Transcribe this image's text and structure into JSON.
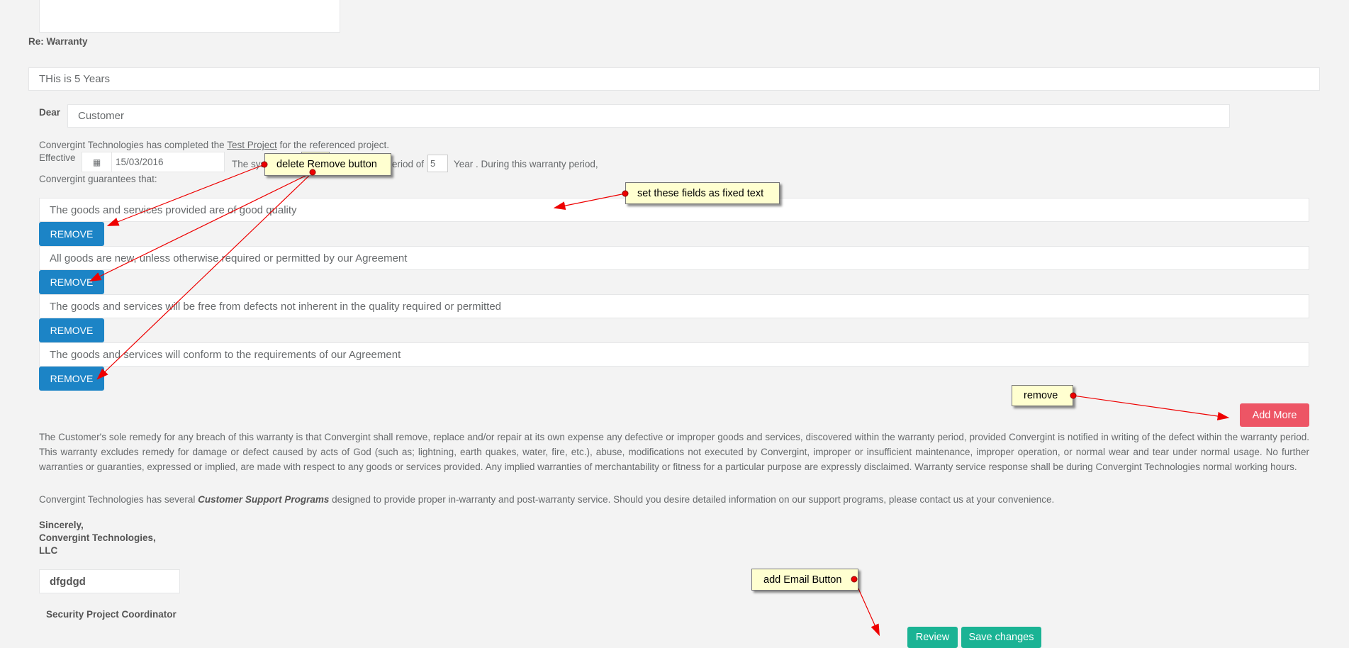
{
  "re_label": "Re: Warranty",
  "subject_value": "THis is 5 Years",
  "dear_label": "Dear",
  "dear_value": "Customer",
  "intro": {
    "before": "Convergint Technologies has completed the ",
    "project_link": "Test Project",
    "after": " for the referenced project."
  },
  "effective_label": "Effective",
  "effective_date": "15/03/2016",
  "system_text": "The sys",
  "period_text": "eriod of",
  "period_value": "5",
  "period_after": "Year . During this warranty period,",
  "guarantee_intro": "Convergint guarantees that:",
  "guarantees": [
    "The goods and services provided are of good quality",
    "All goods are new, unless otherwise required or permitted by our Agreement",
    "The goods and services will be free from defects not inherent in the quality required or permitted",
    "The goods and services will conform to the requirements of our Agreement"
  ],
  "remove_label": "REMOVE",
  "add_more_label": "Add More",
  "remedy_paragraph": "The Customer's sole remedy for any breach of this warranty is that Convergint shall remove, replace and/or repair at its own expense any defective or improper goods and services, discovered within the warranty period, provided Convergint is notified in writing of the defect within the warranty period. This warranty excludes remedy for damage or defect caused by acts of God (such as; lightning, earth quakes, water, fire, etc.), abuse, modifications not executed by Convergint, improper or insufficient maintenance, improper operation, or normal wear and tear under normal usage. No further warranties or guaranties, expressed or implied, are made with respect to any goods or services provided. Any implied warranties of merchantability or fitness for a particular purpose are expressly disclaimed. Warranty service response shall be during Convergint Technologies normal working hours.",
  "support": {
    "before": "Convergint Technologies has several ",
    "bold": "Customer Support Programs",
    "after": " designed to provide proper in-warranty and post-warranty service. Should you desire detailed information on our support programs, please contact us at your convenience."
  },
  "closing": [
    "Sincerely,",
    "Convergint Technologies,",
    "LLC"
  ],
  "signature_value": "dfgdgd",
  "signature_title": "Security Project Coordinator",
  "review_label": "Review",
  "save_label": "Save changes",
  "annotations": {
    "delete_remove": "delete Remove button",
    "fixed_text": "set these fields as fixed text",
    "remove": "remove",
    "add_email": "add Email Button"
  }
}
